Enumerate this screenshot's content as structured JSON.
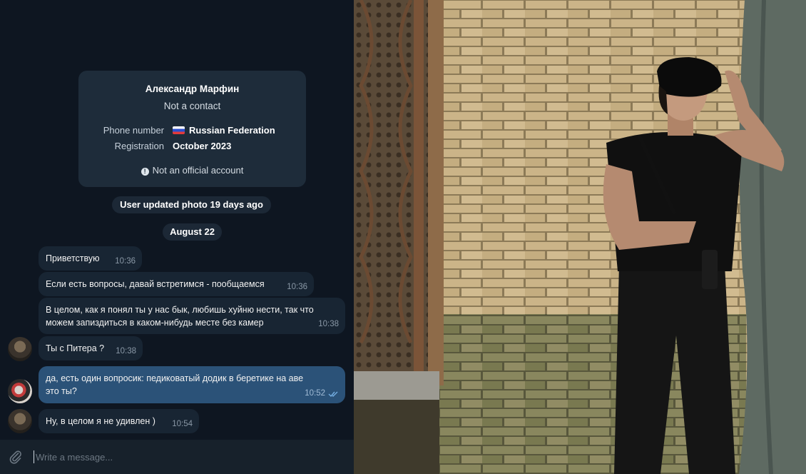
{
  "profile": {
    "name": "Александр Марфин",
    "status": "Not a contact",
    "phone_label": "Phone number",
    "phone_value": "Russian Federation",
    "registration_label": "Registration",
    "registration_value": "October 2023",
    "official_note": "Not an official account"
  },
  "service": {
    "photo_update": "User updated photo 19 days ago",
    "date": "August 22"
  },
  "messages": [
    {
      "text": "Приветствую",
      "time": "10:36",
      "direction": "in"
    },
    {
      "text": "Если есть вопросы, давай встретимся - пообщаемся",
      "time": "10:36",
      "direction": "in"
    },
    {
      "text": "В целом, как я понял ты у нас бык, любишь хуйню нести, так что можем запиздиться в каком-нибудь месте без камер",
      "time": "10:38",
      "direction": "in"
    },
    {
      "text": "Ты с Питера ?",
      "time": "10:38",
      "direction": "in"
    },
    {
      "text": "да, есть один вопросик: педиковатый додик в беретике на аве это ты?",
      "time": "10:52",
      "direction": "out",
      "read": true
    },
    {
      "text": "Ну, в целом я не удивлен )",
      "time": "10:54",
      "direction": "in"
    }
  ],
  "composer": {
    "placeholder": "Write a message..."
  },
  "colors": {
    "chat_bg": "#0e1621",
    "incoming_bubble": "#182533",
    "outgoing_bubble": "#2b5278",
    "composer_bg": "#17212b"
  },
  "icons": [
    "flag-ru-icon",
    "info-icon",
    "double-check-icon",
    "paperclip-icon"
  ]
}
